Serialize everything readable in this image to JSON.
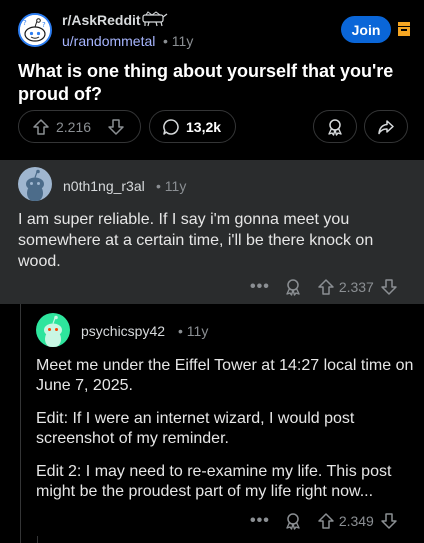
{
  "post": {
    "subreddit": "r/AskReddit",
    "author": "u/randommetal",
    "age": "• 11y",
    "join_label": "Join",
    "title": "What is one thing about yourself that you're proud of?",
    "votes": "2.216",
    "comments": "13,2k"
  },
  "comments": [
    {
      "user": "n0th1ng_r3al",
      "age": "• 11y",
      "body": "I am super reliable. If I say i'm gonna meet you somewhere at a certain time, i'll be there knock on wood.",
      "votes": "2.337",
      "more": "•••"
    },
    {
      "user": "psychicspy42",
      "age": "• 11y",
      "paragraphs": [
        "Meet me under the Eiffel Tower at 14:27 local time on June 7, 2025.",
        "Edit: If I were an internet wizard, I would post screenshot of my reminder.",
        "Edit 2: I may need to re-examine my life.  This post might be the proudest part of my life right now..."
      ],
      "votes": "2.349",
      "more": "•••"
    }
  ],
  "colors": {
    "join": "#0a66d8",
    "card": "#2a2c2d",
    "username": "#a7b6ff",
    "muted": "#8b8f93"
  },
  "icons": [
    "reddit-snoo-icon",
    "bookmark-icon",
    "upvote-icon",
    "downvote-icon",
    "comment-bubble-icon",
    "award-icon",
    "share-icon",
    "more-dots-icon"
  ]
}
